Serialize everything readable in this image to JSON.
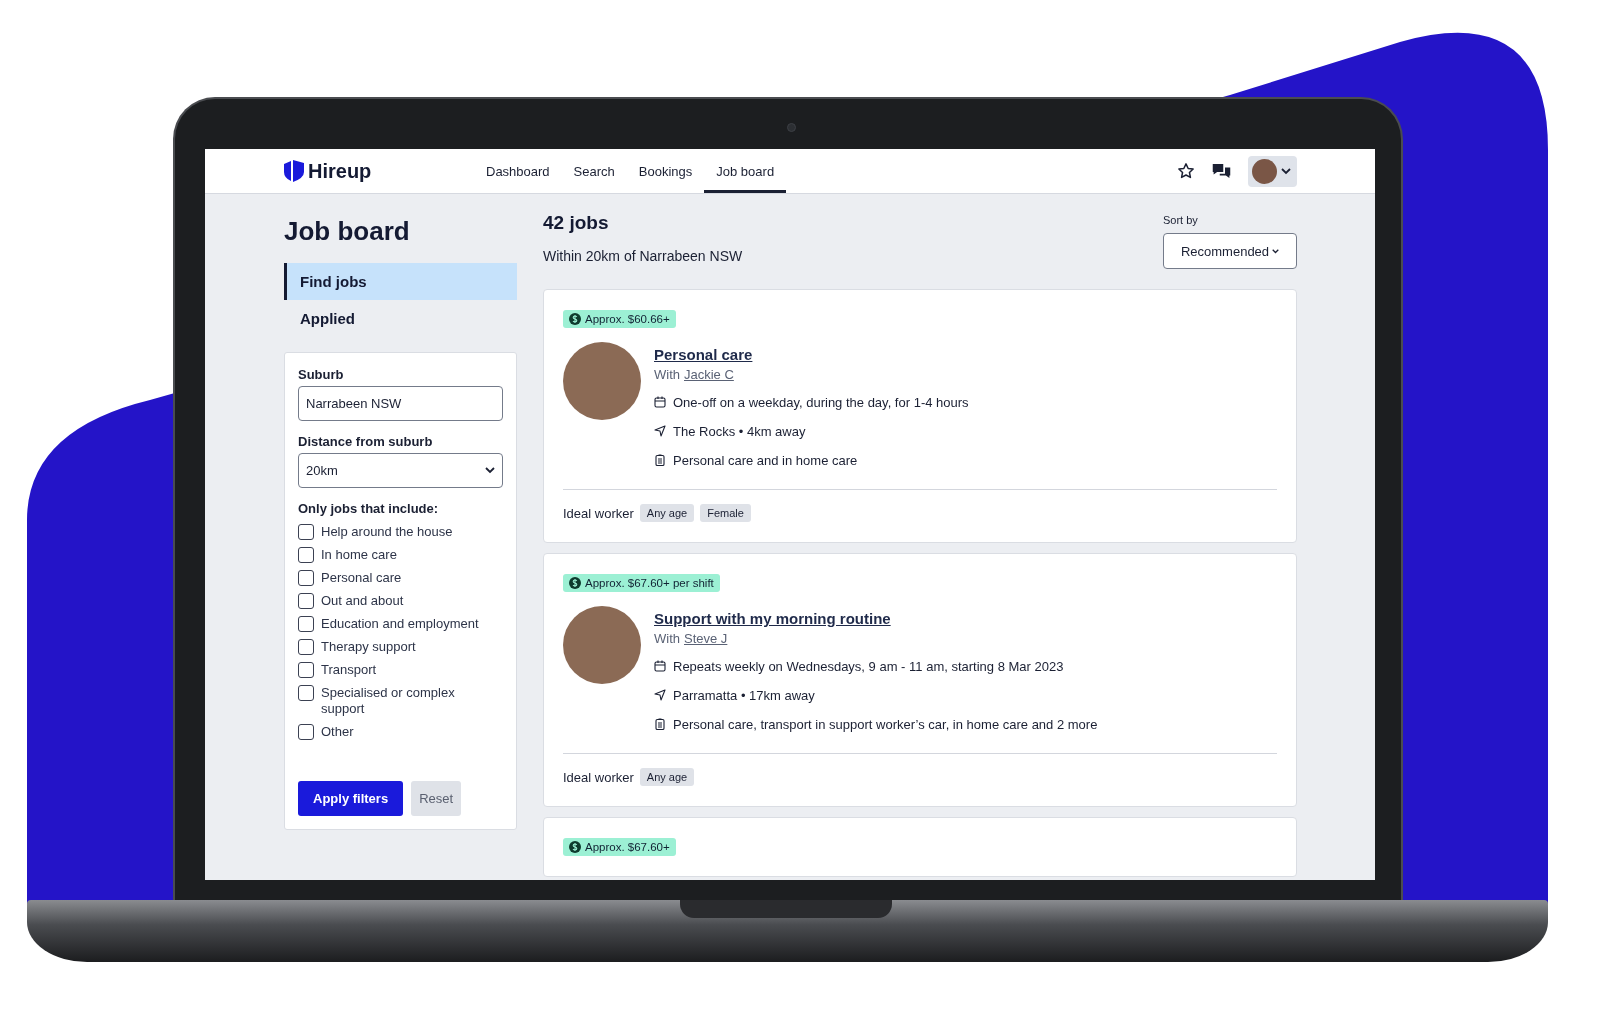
{
  "brand": {
    "name": "Hireup"
  },
  "nav": {
    "items": [
      {
        "label": "Dashboard",
        "selected": false
      },
      {
        "label": "Search",
        "selected": false
      },
      {
        "label": "Bookings",
        "selected": false
      },
      {
        "label": "Job board",
        "selected": true
      }
    ]
  },
  "sidebar": {
    "title": "Job board",
    "items": [
      {
        "label": "Find jobs",
        "selected": true
      },
      {
        "label": "Applied",
        "selected": false
      }
    ]
  },
  "filters": {
    "suburb": {
      "label": "Suburb",
      "value": "Narrabeen NSW"
    },
    "distance": {
      "label": "Distance from suburb",
      "value": "20km"
    },
    "include": {
      "label": "Only jobs that include:",
      "options": [
        {
          "label": "Help around the house",
          "checked": false
        },
        {
          "label": "In home care",
          "checked": false
        },
        {
          "label": "Personal care",
          "checked": false
        },
        {
          "label": "Out and about",
          "checked": false
        },
        {
          "label": "Education and employment",
          "checked": false
        },
        {
          "label": "Therapy support",
          "checked": false
        },
        {
          "label": "Transport",
          "checked": false
        },
        {
          "label": "Specialised or complex support",
          "checked": false
        },
        {
          "label": "Other",
          "checked": false
        }
      ]
    },
    "buttons": [
      {
        "label": "Apply filters",
        "kind": "primary"
      },
      {
        "label": "Reset",
        "kind": "secondary"
      }
    ]
  },
  "results": {
    "count": "42 jobs",
    "location": "Within 20km of Narrabeen NSW",
    "sort": {
      "label": "Sort by",
      "value": "Recommended"
    }
  },
  "jobs": [
    {
      "pay": "Approx. $60.66+",
      "title": "Personal care",
      "with_prefix": "With",
      "client": "Jackie C",
      "schedule": "One-off on a weekday, during the day, for 1-4 hours",
      "place": "The Rocks • 4km away",
      "services": "Personal care and in home care",
      "ideal_label": "Ideal worker",
      "tags": [
        "Any age",
        "Female"
      ]
    },
    {
      "pay": "Approx. $67.60+ per shift",
      "title": "Support with my morning routine",
      "with_prefix": "With",
      "client": "Steve J",
      "schedule": "Repeats weekly on Wednesdays, 9 am - 11 am, starting 8 Mar 2023",
      "place": "Parramatta • 17km away",
      "services": "Personal care, transport in support worker’s car, in home care and 2 more",
      "ideal_label": "Ideal worker",
      "tags": [
        "Any age"
      ]
    },
    {
      "pay": "Approx. $67.60+"
    }
  ]
}
